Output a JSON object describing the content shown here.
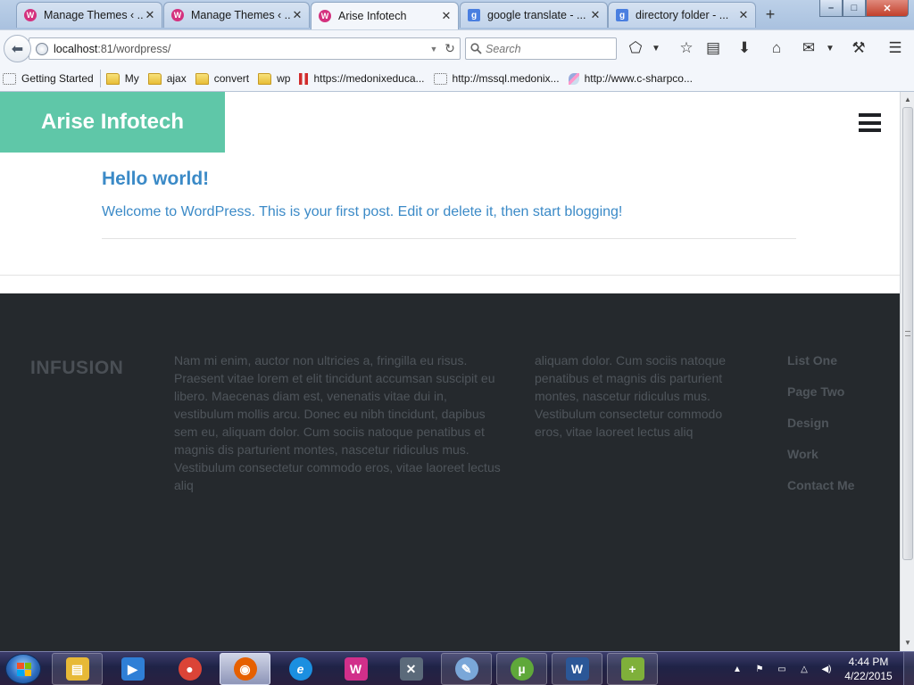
{
  "browser": {
    "tabs": [
      {
        "title": "Manage Themes ‹ ...",
        "favicon": "W",
        "favicon_type": "wordpress"
      },
      {
        "title": "Manage Themes ‹ ...",
        "favicon": "W",
        "favicon_type": "wordpress"
      },
      {
        "title": "Arise Infotech",
        "favicon": "W",
        "favicon_type": "wordpress",
        "active": true
      },
      {
        "title": "google translate - ...",
        "favicon": "g",
        "favicon_type": "google"
      },
      {
        "title": "directory folder - ...",
        "favicon": "g",
        "favicon_type": "google"
      }
    ],
    "tab_close_glyph": "✕",
    "new_tab_glyph": "+",
    "window_controls": {
      "minimize": "–",
      "maximize": "□",
      "close": "✕"
    },
    "address": {
      "host": "localhost",
      "rest": ":81/wordpress/"
    },
    "search_placeholder": "Search",
    "bookmarks": [
      {
        "label": "Getting Started",
        "icon": "dotted"
      },
      {
        "label": "My",
        "icon": "folder"
      },
      {
        "label": "ajax",
        "icon": "folder"
      },
      {
        "label": "convert",
        "icon": "folder"
      },
      {
        "label": "wp",
        "icon": "folder"
      },
      {
        "label": "https://medonixeduca...",
        "icon": "red"
      },
      {
        "label": "http://mssql.medonix...",
        "icon": "dotted"
      },
      {
        "label": "http://www.c-sharpco...",
        "icon": "feather"
      }
    ]
  },
  "site": {
    "title": "Arise Infotech",
    "accent_color": "#5fc7a8",
    "link_color": "#3b8ac7",
    "post": {
      "title": "Hello world!",
      "body": "Welcome to WordPress. This is your first post. Edit or delete it, then start blogging!"
    },
    "footer": {
      "logo": "INFUSION",
      "col1": "Nam mi enim, auctor non ultricies a, fringilla eu risus. Praesent vitae lorem et elit tincidunt accumsan suscipit eu libero. Maecenas diam est, venenatis vitae dui in, vestibulum mollis arcu. Donec eu nibh tincidunt, dapibus sem eu, aliquam dolor. Cum sociis natoque penatibus et magnis dis parturient montes, nascetur ridiculus mus. Vestibulum consectetur commodo eros, vitae laoreet lectus aliq",
      "col2": "aliquam dolor. Cum sociis natoque penatibus et magnis dis parturient montes, nascetur ridiculus mus. Vestibulum consectetur commodo eros, vitae laoreet lectus aliq",
      "menu": [
        "List One",
        "Page Two",
        "Design",
        "Work",
        "Contact Me"
      ]
    }
  },
  "taskbar": {
    "apps": [
      {
        "name": "file-explorer-icon",
        "glyph": "▤",
        "color": "#e7b937"
      },
      {
        "name": "media-player-icon",
        "glyph": "▶",
        "color": "#2f7fd6"
      },
      {
        "name": "chrome-icon",
        "glyph": "●",
        "color": "#db4437"
      },
      {
        "name": "firefox-icon",
        "glyph": "◉",
        "color": "#e66000"
      },
      {
        "name": "internet-explorer-icon",
        "glyph": "e",
        "color": "#1b8fe0"
      },
      {
        "name": "wamp-icon",
        "glyph": "W",
        "color": "#d12f8a"
      },
      {
        "name": "build-tools-icon",
        "glyph": "✕",
        "color": "#5b6a7a"
      },
      {
        "name": "paint-icon",
        "glyph": "✎",
        "color": "#7aa7d8"
      },
      {
        "name": "utorrent-icon",
        "glyph": "µ",
        "color": "#5fa83a"
      },
      {
        "name": "word-icon",
        "glyph": "W",
        "color": "#2b5797"
      },
      {
        "name": "notepad-plus-icon",
        "glyph": "+",
        "color": "#7fb03a"
      }
    ],
    "clock": {
      "time": "4:44 PM",
      "date": "4/22/2015"
    }
  }
}
